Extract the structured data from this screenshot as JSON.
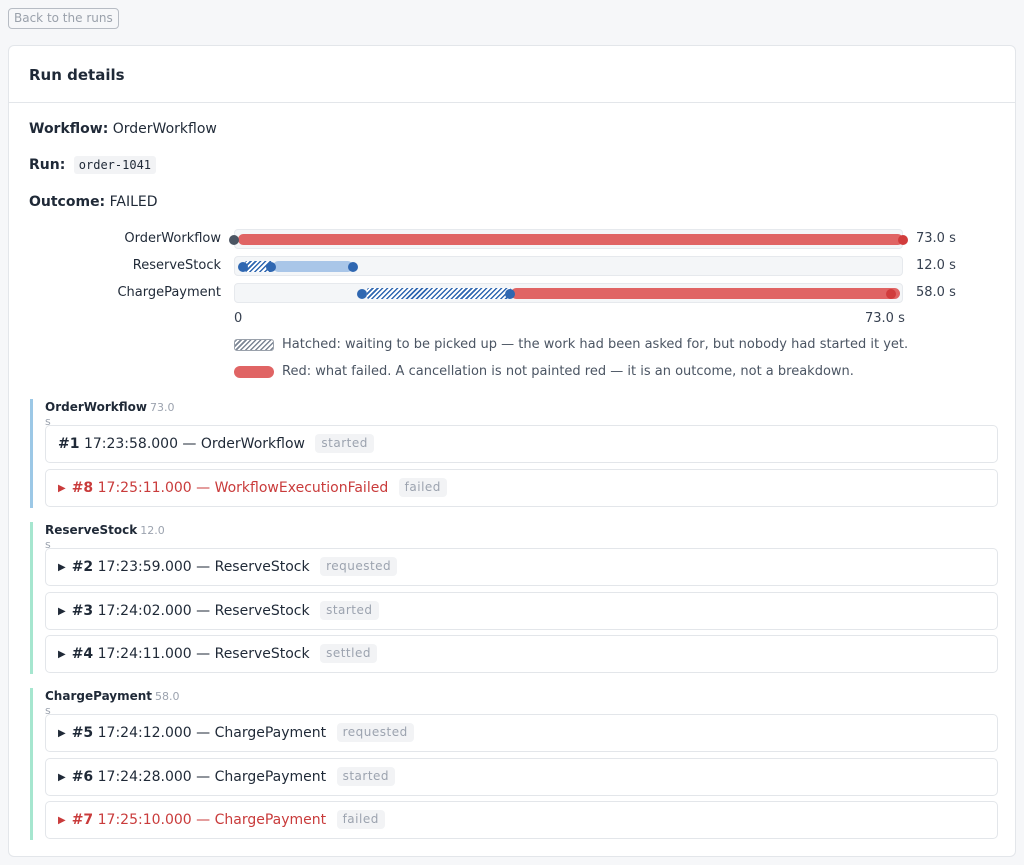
{
  "back_button": "Back to the runs",
  "panel_title": "Run details",
  "fields": {
    "workflow_label": "Workflow:",
    "workflow_value": "OrderWorkflow",
    "run_label": "Run:",
    "run_value": "order-1041",
    "outcome_label": "Outcome:",
    "outcome_value": "FAILED"
  },
  "timeline": {
    "rows": [
      {
        "name": "OrderWorkflow",
        "duration": "73.0 s"
      },
      {
        "name": "ReserveStock",
        "duration": "12.0 s"
      },
      {
        "name": "ChargePayment",
        "duration": "58.0 s"
      }
    ],
    "axis_start": "0",
    "axis_end": "73.0 s",
    "colors": {
      "failed": "#e06464",
      "running": "#a9c6e8",
      "waiting_hatch": "#2f67b1",
      "marker": "#2f67b1",
      "fail_marker": "#d13c3c",
      "start_marker": "#4b5563"
    }
  },
  "legend": {
    "hatched": "Hatched: waiting to be picked up — the work had been asked for, but nobody had started it yet.",
    "red": "Red: what failed. A cancellation is not painted red — it is an outcome, not a breakdown."
  },
  "groups": [
    {
      "name": "OrderWorkflow",
      "duration": "73.0 s",
      "border_color": "#9cc8e6",
      "events": [
        {
          "num": "#1",
          "text": "17:23:58.000 — OrderWorkflow",
          "badge": "started",
          "failed": false,
          "expandable": false
        },
        {
          "num": "#8",
          "text": "17:25:11.000 — WorkflowExecutionFailed",
          "badge": "failed",
          "failed": true,
          "expandable": true
        }
      ]
    },
    {
      "name": "ReserveStock",
      "duration": "12.0 s",
      "border_color": "#a6e6cf",
      "events": [
        {
          "num": "#2",
          "text": "17:23:59.000 — ReserveStock",
          "badge": "requested",
          "failed": false,
          "expandable": true
        },
        {
          "num": "#3",
          "text": "17:24:02.000 — ReserveStock",
          "badge": "started",
          "failed": false,
          "expandable": true
        },
        {
          "num": "#4",
          "text": "17:24:11.000 — ReserveStock",
          "badge": "settled",
          "failed": false,
          "expandable": true
        }
      ]
    },
    {
      "name": "ChargePayment",
      "duration": "58.0 s",
      "border_color": "#a6e6cf",
      "events": [
        {
          "num": "#5",
          "text": "17:24:12.000 — ChargePayment",
          "badge": "requested",
          "failed": false,
          "expandable": true
        },
        {
          "num": "#6",
          "text": "17:24:28.000 — ChargePayment",
          "badge": "started",
          "failed": false,
          "expandable": true
        },
        {
          "num": "#7",
          "text": "17:25:10.000 — ChargePayment",
          "badge": "failed",
          "failed": true,
          "expandable": true
        }
      ]
    }
  ]
}
